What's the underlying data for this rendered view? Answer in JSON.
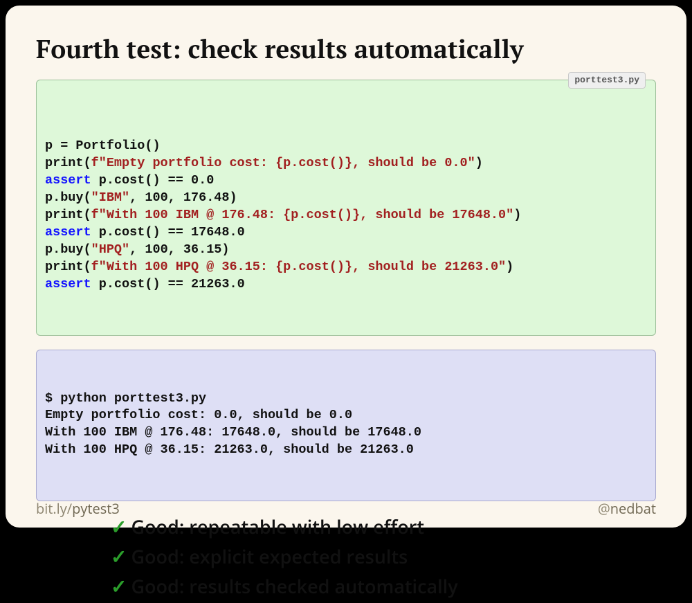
{
  "title": "Fourth test: check results automatically",
  "code_filename": "porttest3.py",
  "code_lines": [
    [
      {
        "t": "p ",
        "c": "tok-punct"
      },
      {
        "t": "=",
        "c": "tok-punct"
      },
      {
        "t": " Portfolio()",
        "c": "tok-punct"
      }
    ],
    [
      {
        "t": "print",
        "c": "tok-fn"
      },
      {
        "t": "(",
        "c": "tok-punct"
      },
      {
        "t": "f\"Empty portfolio cost: ",
        "c": "tok-str"
      },
      {
        "t": "{p.cost()}",
        "c": "tok-str"
      },
      {
        "t": ", should be 0.0\"",
        "c": "tok-str"
      },
      {
        "t": ")",
        "c": "tok-punct"
      }
    ],
    [
      {
        "t": "assert",
        "c": "tok-kw"
      },
      {
        "t": " p.cost() ",
        "c": "tok-punct"
      },
      {
        "t": "==",
        "c": "tok-punct"
      },
      {
        "t": " ",
        "c": "tok-punct"
      },
      {
        "t": "0.0",
        "c": "tok-num"
      }
    ],
    [
      {
        "t": "p.buy(",
        "c": "tok-punct"
      },
      {
        "t": "\"IBM\"",
        "c": "tok-str"
      },
      {
        "t": ", ",
        "c": "tok-punct"
      },
      {
        "t": "100",
        "c": "tok-num"
      },
      {
        "t": ", ",
        "c": "tok-punct"
      },
      {
        "t": "176.48",
        "c": "tok-num"
      },
      {
        "t": ")",
        "c": "tok-punct"
      }
    ],
    [
      {
        "t": "print",
        "c": "tok-fn"
      },
      {
        "t": "(",
        "c": "tok-punct"
      },
      {
        "t": "f\"With 100 IBM @ 176.48: ",
        "c": "tok-str"
      },
      {
        "t": "{p.cost()}",
        "c": "tok-str"
      },
      {
        "t": ", should be 17648.0\"",
        "c": "tok-str"
      },
      {
        "t": ")",
        "c": "tok-punct"
      }
    ],
    [
      {
        "t": "assert",
        "c": "tok-kw"
      },
      {
        "t": " p.cost() ",
        "c": "tok-punct"
      },
      {
        "t": "==",
        "c": "tok-punct"
      },
      {
        "t": " ",
        "c": "tok-punct"
      },
      {
        "t": "17648.0",
        "c": "tok-num"
      }
    ],
    [
      {
        "t": "p.buy(",
        "c": "tok-punct"
      },
      {
        "t": "\"HPQ\"",
        "c": "tok-str"
      },
      {
        "t": ", ",
        "c": "tok-punct"
      },
      {
        "t": "100",
        "c": "tok-num"
      },
      {
        "t": ", ",
        "c": "tok-punct"
      },
      {
        "t": "36.15",
        "c": "tok-num"
      },
      {
        "t": ")",
        "c": "tok-punct"
      }
    ],
    [
      {
        "t": "print",
        "c": "tok-fn"
      },
      {
        "t": "(",
        "c": "tok-punct"
      },
      {
        "t": "f\"With 100 HPQ @ 36.15: ",
        "c": "tok-str"
      },
      {
        "t": "{p.cost()}",
        "c": "tok-str"
      },
      {
        "t": ", should be 21263.0\"",
        "c": "tok-str"
      },
      {
        "t": ")",
        "c": "tok-punct"
      }
    ],
    [
      {
        "t": "assert",
        "c": "tok-kw"
      },
      {
        "t": " p.cost() ",
        "c": "tok-punct"
      },
      {
        "t": "==",
        "c": "tok-punct"
      },
      {
        "t": " ",
        "c": "tok-punct"
      },
      {
        "t": "21263.0",
        "c": "tok-num"
      }
    ]
  ],
  "output_lines": [
    "$ python porttest3.py",
    "Empty portfolio cost: 0.0, should be 0.0",
    "With 100 IBM @ 176.48: 17648.0, should be 17648.0",
    "With 100 HPQ @ 36.15: 21263.0, should be 21263.0"
  ],
  "bullets": [
    "Good: repeatable with low effort",
    "Good: explicit expected results",
    "Good: results checked automatically"
  ],
  "footer": {
    "left_prefix": "bit.ly/",
    "left_strong": "pytest3",
    "right_prefix": "@",
    "right_strong": "nedbat"
  }
}
